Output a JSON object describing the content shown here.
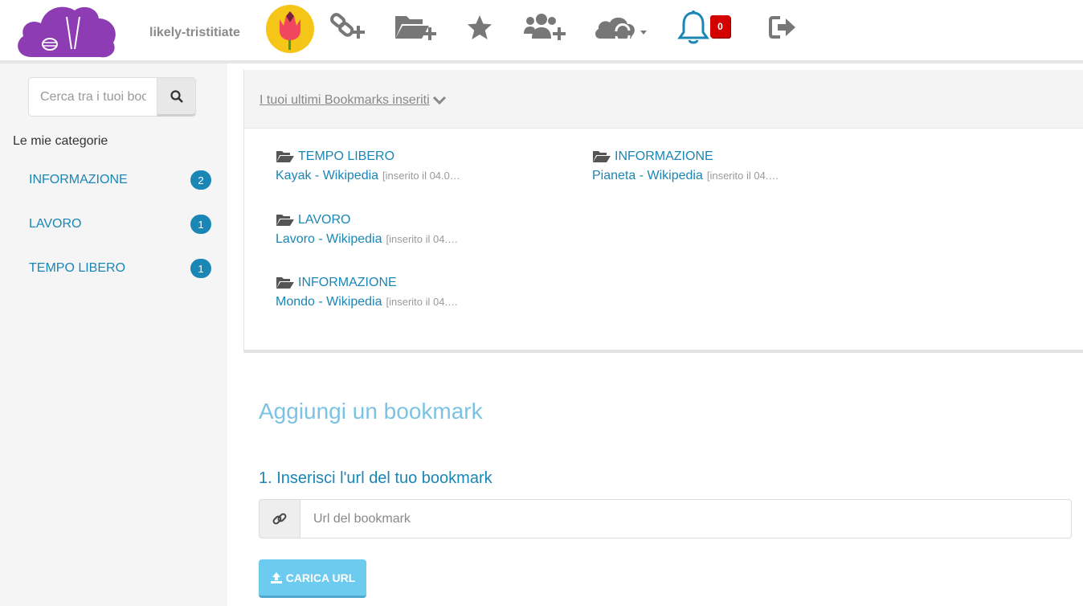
{
  "header": {
    "username": "likely-tristitiate",
    "notifications_count": "0",
    "icons": [
      "logo-cloud-icon",
      "avatar-tulip-icon",
      "add-link-icon",
      "add-folder-icon",
      "star-icon",
      "add-users-icon",
      "cloud-sync-icon",
      "bell-icon",
      "logout-icon"
    ]
  },
  "sidebar": {
    "search_placeholder": "Cerca tra i tuoi bookmark",
    "categories_title": "Le mie categorie",
    "categories": [
      {
        "label": "INFORMAZIONE",
        "count": "2"
      },
      {
        "label": "LAVORO",
        "count": "1"
      },
      {
        "label": "TEMPO LIBERO",
        "count": "1"
      }
    ]
  },
  "recent": {
    "title": "I tuoi ultimi Bookmarks inseriti",
    "items": [
      {
        "category": "TEMPO LIBERO",
        "title": "Kayak - Wikipedia",
        "date": "[inserito il 04.0…"
      },
      {
        "category": "INFORMAZIONE",
        "title": "Pianeta - Wikipedia",
        "date": "[inserito il 04.…"
      },
      {
        "category": "LAVORO",
        "title": "Lavoro - Wikipedia",
        "date": "[inserito il 04.…"
      },
      {
        "category": "INFORMAZIONE",
        "title": "Mondo - Wikipedia",
        "date": "[inserito il 04.…"
      }
    ]
  },
  "add": {
    "title": "Aggiungi un bookmark",
    "step1": "1. Inserisci l'url del tuo bookmark",
    "url_placeholder": "Url del bookmark",
    "load_button": "CARICA URL"
  },
  "colors": {
    "link": "#1a86b5",
    "logo": "#8e3cb3",
    "badge_red": "#d40000",
    "button": "#6ecbf0"
  }
}
